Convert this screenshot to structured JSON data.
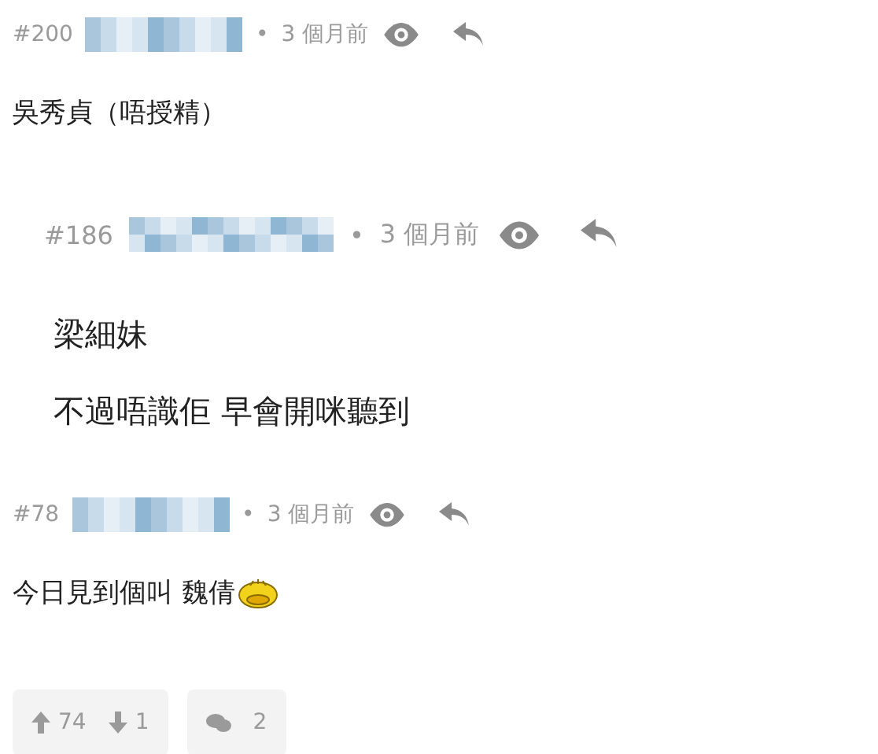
{
  "comments": [
    {
      "kind": "post",
      "number": "#200",
      "separator": "•",
      "time": "3 個月前",
      "lines": [
        "吳秀貞（唔授精）"
      ],
      "emoticon": false
    },
    {
      "kind": "quote",
      "number": "#186",
      "separator": "•",
      "time": "3 個月前",
      "lines": [
        "梁細妹",
        "不過唔識佢 早會開咪聽到"
      ],
      "emoticon": false
    },
    {
      "kind": "post",
      "number": "#78",
      "separator": "•",
      "time": "3 個月前",
      "lines": [
        "今日見到個叫 魏倩"
      ],
      "emoticon": true
    }
  ],
  "actions": {
    "upvotes": "74",
    "downvotes": "1",
    "replies": "2"
  }
}
